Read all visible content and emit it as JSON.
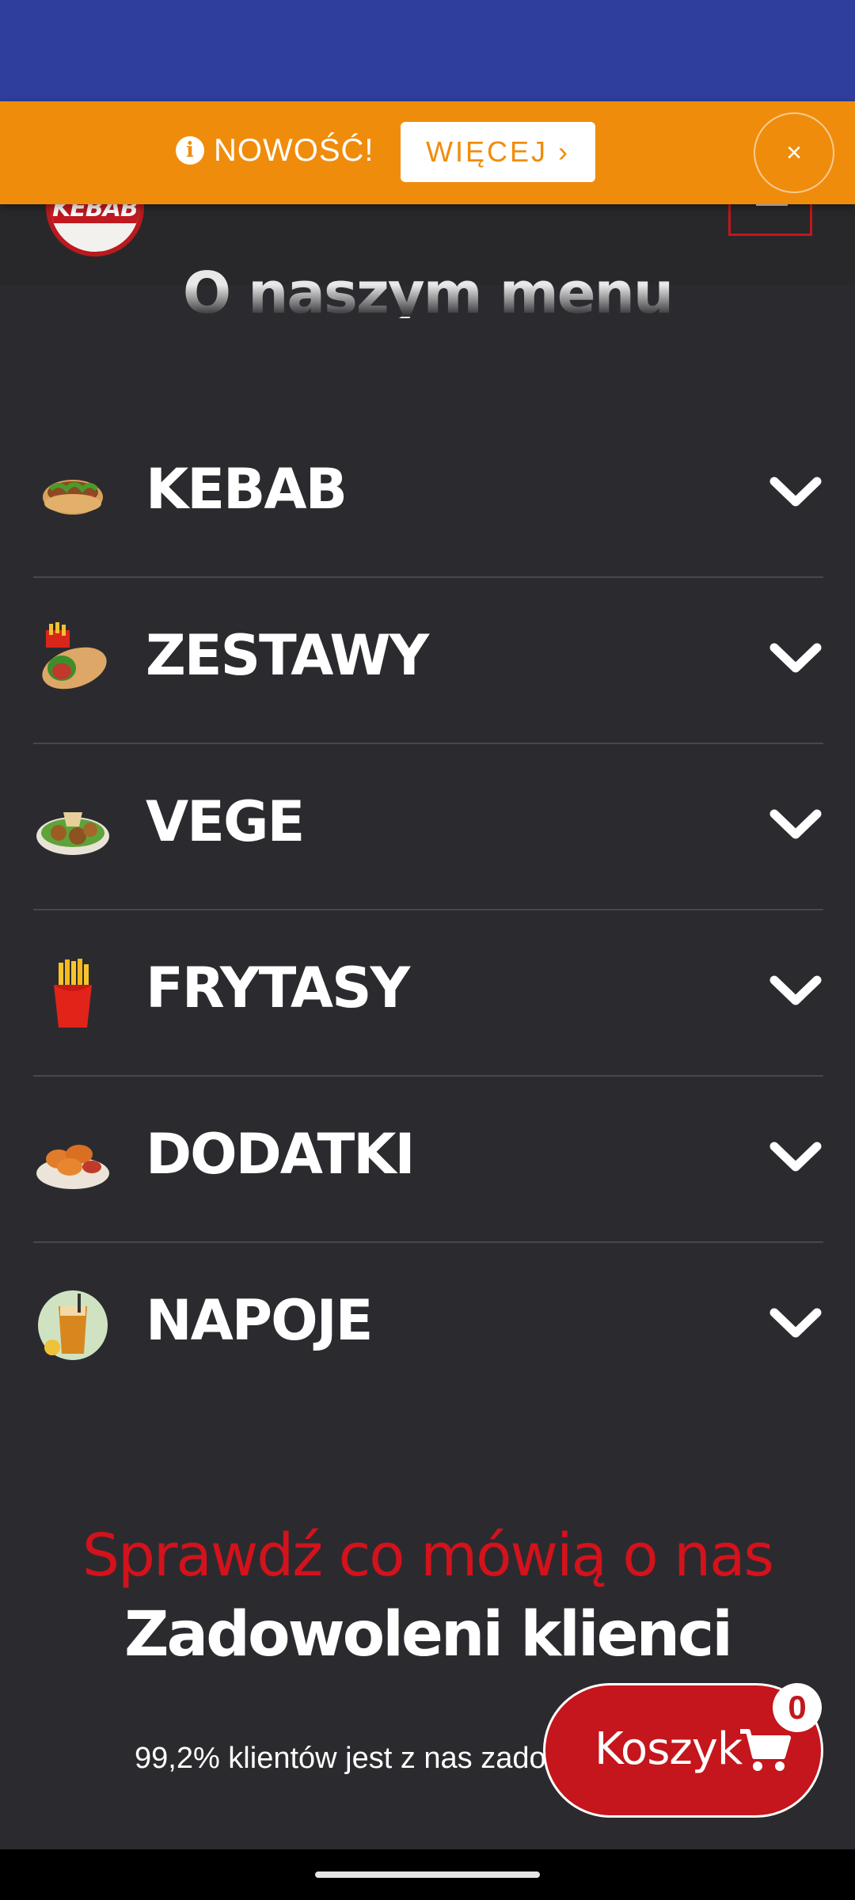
{
  "notice": {
    "icon": "info-circle-icon",
    "icon_glyph": "i",
    "text": "NOWOŚĆ!",
    "more_label": "WIĘCEJ ›",
    "close_label": "×",
    "color": "#f08c0c"
  },
  "header": {
    "logo_text": "KEBAB",
    "brand_color": "#c4161c"
  },
  "section_title": "O naszym menu",
  "menu": {
    "items": [
      {
        "label": "KEBAB",
        "icon": "kebab-icon"
      },
      {
        "label": "ZESTAWY",
        "icon": "wrap-set-icon"
      },
      {
        "label": "VEGE",
        "icon": "falafel-salad-icon"
      },
      {
        "label": "FRYTASY",
        "icon": "fries-icon"
      },
      {
        "label": "DODATKI",
        "icon": "nuggets-icon"
      },
      {
        "label": "NAPOJE",
        "icon": "drink-icon"
      }
    ]
  },
  "testimonials": {
    "eyebrow": "Sprawdź co mówią o nas",
    "title": "Zadowoleni klienci",
    "satisfaction": "99,2% klientów jest z nas zadowolonych"
  },
  "cart": {
    "label": "Koszyk",
    "count": "0",
    "icon": "cart-icon"
  }
}
